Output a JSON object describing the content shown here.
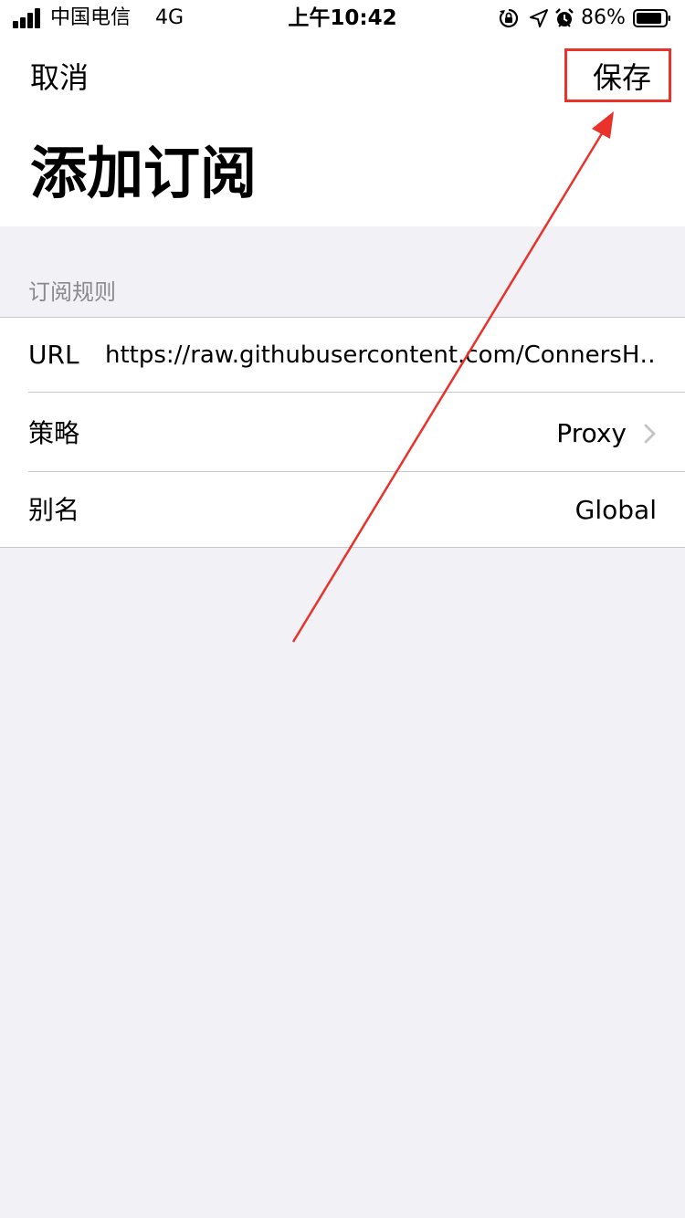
{
  "status_bar": {
    "carrier": "中国电信",
    "network": "4G",
    "time": "上午10:42",
    "battery_percent": "86%",
    "icons": [
      "orientation-lock-icon",
      "location-icon",
      "alarm-icon",
      "battery-icon"
    ]
  },
  "nav": {
    "cancel_label": "取消",
    "save_label": "保存",
    "title": "添加订阅"
  },
  "section": {
    "header": "订阅规则",
    "rows": [
      {
        "label": "URL",
        "value": "https://raw.githubusercontent.com/ConnersH…"
      },
      {
        "label": "策略",
        "value": "Proxy"
      },
      {
        "label": "别名",
        "value": "Global"
      }
    ]
  },
  "colors": {
    "background": "#f2f1f6",
    "annotation_red": "#e8322a",
    "secondary_text": "#8a8a8e",
    "chevron": "#c4c4c7"
  }
}
